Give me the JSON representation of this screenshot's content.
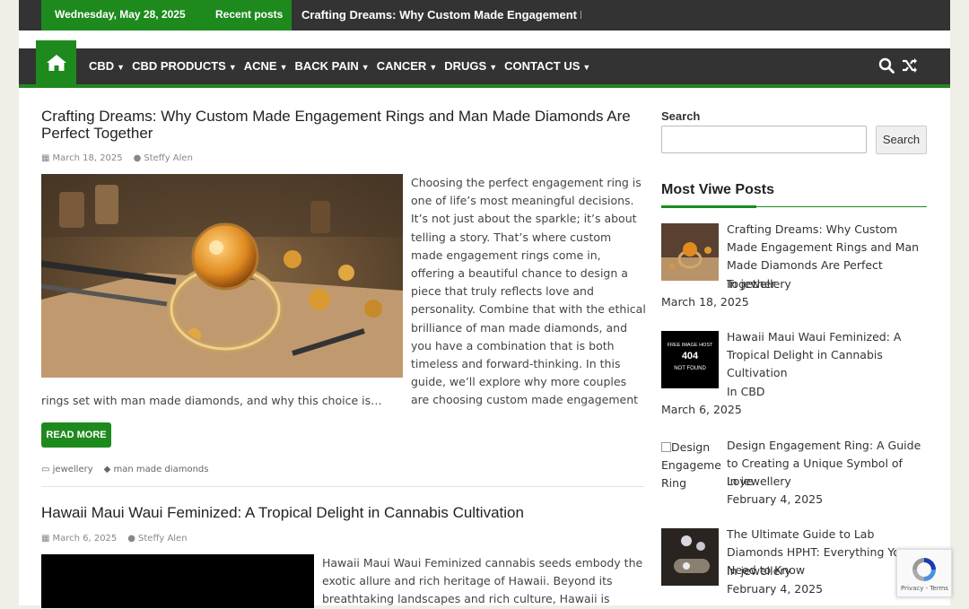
{
  "topbar": {
    "date": "Wednesday, May 28, 2025",
    "recent_label": "Recent posts",
    "ticker": "Crafting Dreams: Why Custom Made Engagement Rings and Man Made Diamonds Are Perfect Together"
  },
  "nav": {
    "items": [
      {
        "label": "CBD"
      },
      {
        "label": "CBD PRODUCTS"
      },
      {
        "label": "ACNE"
      },
      {
        "label": "BACK PAIN"
      },
      {
        "label": "CANCER"
      },
      {
        "label": "DRUGS"
      },
      {
        "label": "CONTACT US"
      }
    ],
    "icons": [
      "home-icon",
      "search-icon",
      "shuffle-icon"
    ]
  },
  "posts": [
    {
      "title": "Crafting Dreams: Why Custom Made Engagement Rings and Man Made Diamonds Are Perfect Together",
      "date": "March 18, 2025",
      "author": "Steffy Alen",
      "excerpt_side": "Choosing the perfect engagement ring is one of life’s most meaningful decisions. It’s not just about the sparkle; it’s about telling a story. That’s where custom made engagement rings come in, offering a beautiful chance to design a piece that truly reflects love and personality. Combine that with the ethical brilliance of man made diamonds, and you have a combination that is both timeless and forward-thinking. In this guide, we’ll explore why more couples are choosing custom made engagement",
      "excerpt_tail": "rings set with man made diamonds, and why this choice is…",
      "read_more": "READ MORE",
      "category": "jewellery",
      "tag": "man made diamonds"
    },
    {
      "title": "Hawaii Maui Waui Feminized: A Tropical Delight in Cannabis Cultivation",
      "date": "March 6, 2025",
      "author": "Steffy Alen",
      "excerpt": "Hawaii Maui Waui Feminized cannabis seeds embody the exotic allure and rich heritage of Hawaii. Beyond its breathtaking landscapes and rich culture, Hawaii is"
    }
  ],
  "sidebar": {
    "search_label": "Search",
    "search_button": "Search",
    "search_value": "",
    "most_viewed_heading": "Most Viwe Posts",
    "items": [
      {
        "title": "Crafting Dreams: Why Custom Made Engagement Rings and Man Made Diamonds Are Perfect Together",
        "category": "In jewellery",
        "date": "March 18, 2025"
      },
      {
        "title": "Hawaii Maui Waui Feminized: A Tropical Delight in Cannabis Cultivation",
        "category": "In CBD",
        "date": "March 6, 2025",
        "thumb_text": {
          "line1": "FREE IMAGE HOST",
          "line2": "404",
          "line3": "NOT FOUND"
        }
      },
      {
        "title": "Design Engagement Ring: A Guide to Creating a Unique Symbol of Love",
        "category": "In jewellery",
        "date": "February 4, 2025",
        "alt": "Design Engagement Ring"
      },
      {
        "title": "The Ultimate Guide to Lab Diamonds HPHT: Everything You Need to Know",
        "category": "In jewellery",
        "date": "February 4, 2025"
      }
    ]
  },
  "recaptcha": {
    "text": "Privacy - Terms"
  },
  "colors": {
    "accent": "#1e8a1e",
    "dark": "#333333"
  }
}
